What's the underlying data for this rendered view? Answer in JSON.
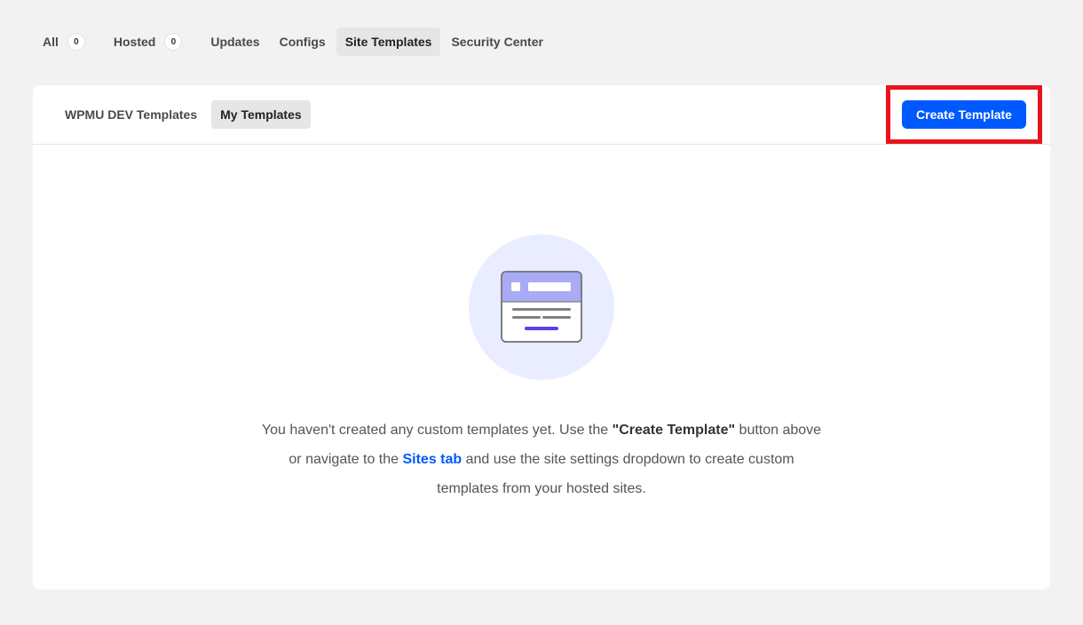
{
  "top_tabs": [
    {
      "label": "All",
      "count": "0"
    },
    {
      "label": "Hosted",
      "count": "0"
    },
    {
      "label": "Updates"
    },
    {
      "label": "Configs"
    },
    {
      "label": "Site Templates",
      "active": true
    },
    {
      "label": "Security Center"
    }
  ],
  "panel": {
    "sub_tabs": [
      {
        "label": "WPMU DEV Templates"
      },
      {
        "label": "My Templates",
        "active": true
      }
    ],
    "create_button_label": "Create Template",
    "empty": {
      "illustration_icon": "template-browser-icon",
      "text_part1": "You haven't created any custom templates yet. Use the ",
      "text_bold": "\"Create Template\"",
      "text_part2": " button above or navigate to the ",
      "link_label": "Sites tab",
      "text_part3": " and use the site settings dropdown to create custom templates from your hosted sites."
    }
  },
  "colors": {
    "accent": "#0059ff",
    "highlight": "#e8141c",
    "illustration_bg": "#e9edff"
  }
}
